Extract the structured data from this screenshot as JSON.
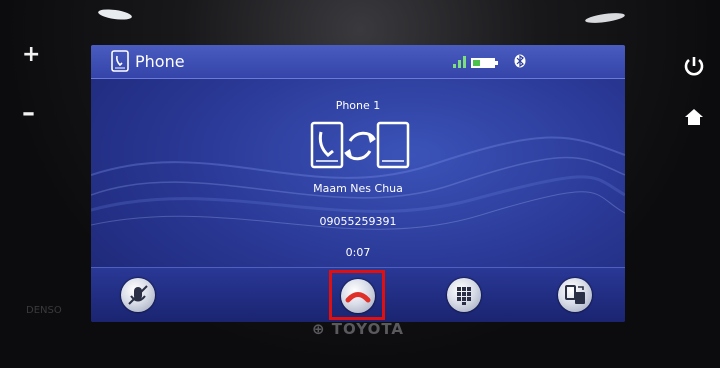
{
  "header": {
    "title": "Phone"
  },
  "call": {
    "phone_label": "Phone 1",
    "contact_name": "Maam Nes Chua",
    "number": "09055259391",
    "duration": "0:07"
  },
  "brand": {
    "name": "TOYOTA",
    "maker": "DENSO"
  },
  "icons": {
    "status": [
      "signal-icon",
      "battery-icon",
      "bluetooth-icon"
    ],
    "bottom": [
      "voice-mute-icon",
      "end-call-icon",
      "keypad-icon",
      "transfer-audio-icon"
    ]
  },
  "colors": {
    "screen": "#2b3a98",
    "highlight": "#e01010"
  }
}
